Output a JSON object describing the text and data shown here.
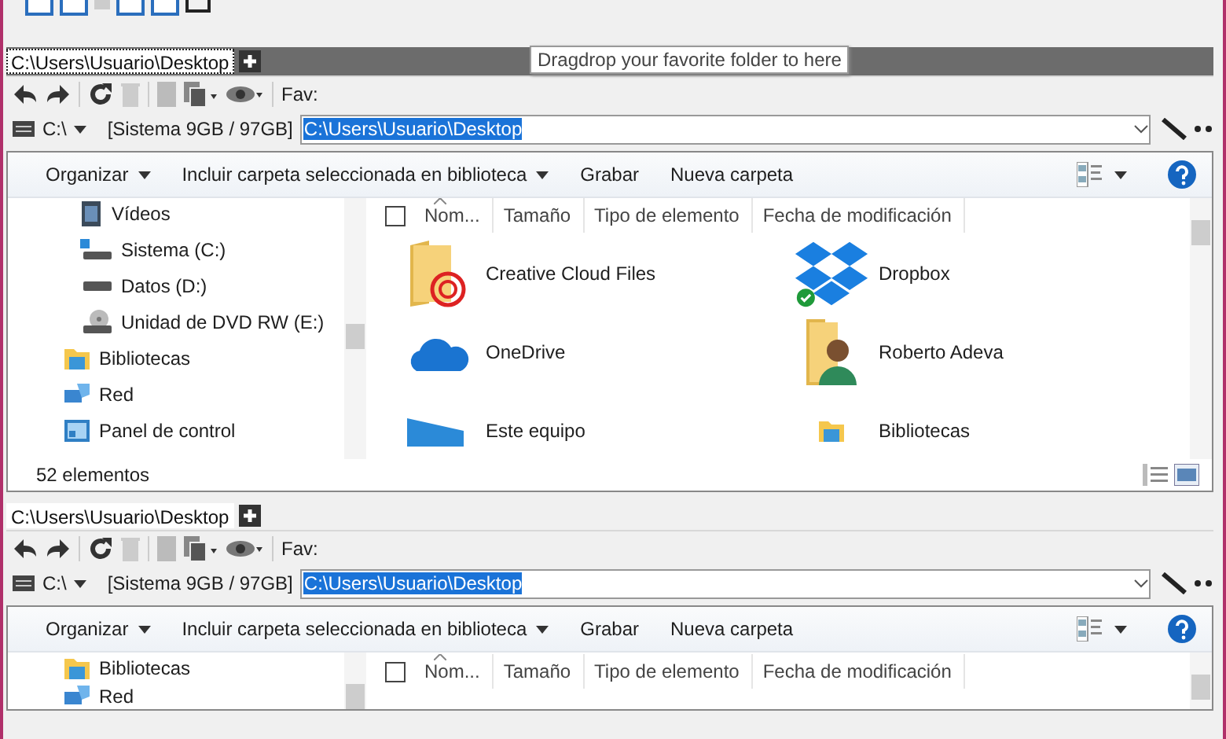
{
  "panes": [
    {
      "active": true,
      "tab": {
        "label": "C:\\Users\\Usuario\\Desktop",
        "selected": true
      },
      "tooltip": "Dragdrop your favorite folder to here",
      "fav_label": "Fav:",
      "drive": "C:\\",
      "drive_info": "[Sistema 9GB / 97GB]",
      "address": {
        "value": "C:\\Users\\Usuario\\Desktop",
        "selected": true
      },
      "commands": [
        {
          "label": "Organizar",
          "dropdown": true
        },
        {
          "label": "Incluir carpeta seleccionada en biblioteca",
          "dropdown": true
        },
        {
          "label": "Grabar",
          "dropdown": false
        },
        {
          "label": "Nueva carpeta",
          "dropdown": false
        }
      ],
      "tree": [
        {
          "label": "Vídeos",
          "kind": "videos"
        },
        {
          "label": "Sistema (C:)",
          "kind": "system-drive"
        },
        {
          "label": "Datos (D:)",
          "kind": "drive"
        },
        {
          "label": "Unidad de DVD RW (E:)",
          "kind": "dvd"
        },
        {
          "label": "Bibliotecas",
          "kind": "library"
        },
        {
          "label": "Red",
          "kind": "network"
        },
        {
          "label": "Panel de control",
          "kind": "control-panel"
        }
      ],
      "select_all_checked": false,
      "columns": [
        {
          "label": "Nom...",
          "sorted": true
        },
        {
          "label": "Tamaño",
          "sorted": false
        },
        {
          "label": "Tipo de elemento",
          "sorted": false
        },
        {
          "label": "Fecha de modificación",
          "sorted": false
        }
      ],
      "files": [
        {
          "name": "Creative Cloud Files",
          "kind": "cc-folder"
        },
        {
          "name": "Dropbox",
          "kind": "dropbox"
        },
        {
          "name": "OneDrive",
          "kind": "onedrive"
        },
        {
          "name": "Roberto Adeva",
          "kind": "user-folder"
        },
        {
          "name": "Este equipo",
          "kind": "pc"
        },
        {
          "name": "Bibliotecas",
          "kind": "library"
        }
      ],
      "status": "52 elementos"
    },
    {
      "active": false,
      "tab": {
        "label": "C:\\Users\\Usuario\\Desktop",
        "selected": true
      },
      "fav_label": "Fav:",
      "drive": "C:\\",
      "drive_info": "[Sistema 9GB / 97GB]",
      "address": {
        "value": "C:\\Users\\Usuario\\Desktop",
        "selected": true
      },
      "commands": [
        {
          "label": "Organizar",
          "dropdown": true
        },
        {
          "label": "Incluir carpeta seleccionada en biblioteca",
          "dropdown": true
        },
        {
          "label": "Grabar",
          "dropdown": false
        },
        {
          "label": "Nueva carpeta",
          "dropdown": false
        }
      ],
      "tree": [
        {
          "label": "Bibliotecas",
          "kind": "library"
        },
        {
          "label": "Red",
          "kind": "network"
        }
      ],
      "select_all_checked": false,
      "columns": [
        {
          "label": "Nom...",
          "sorted": true
        },
        {
          "label": "Tamaño",
          "sorted": false
        },
        {
          "label": "Tipo de elemento",
          "sorted": false
        },
        {
          "label": "Fecha de modificación",
          "sorted": false
        }
      ]
    }
  ]
}
